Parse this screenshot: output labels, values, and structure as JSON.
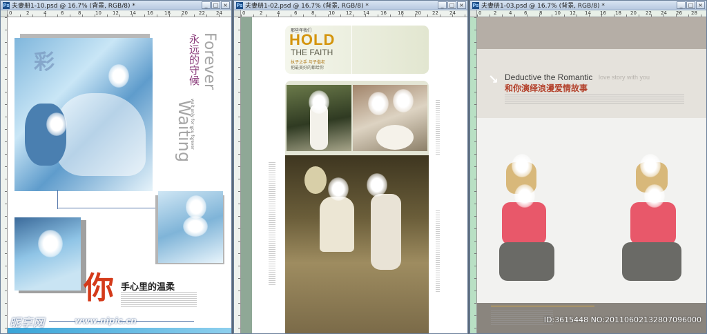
{
  "windows": [
    {
      "title": "夫妻册1-10.psd @ 16.7% (背景, RGB/8) *",
      "ruler_numbers": [
        "0",
        "2",
        "4",
        "6",
        "8",
        "10",
        "12",
        "14",
        "16",
        "18",
        "20",
        "22",
        "24"
      ],
      "ruler_left": [
        "1",
        "2",
        "3",
        "4",
        "5",
        "6",
        "7",
        "8",
        "9",
        "1",
        "1",
        "2"
      ]
    },
    {
      "title": "夫妻册1-02.psd @ 16.7% (背景, RGB/8) *",
      "ruler_numbers": [
        "0",
        "2",
        "4",
        "6",
        "8",
        "10",
        "12",
        "14",
        "16",
        "18",
        "20",
        "22",
        "24"
      ],
      "ruler_left": [
        "1",
        "2",
        "3",
        "4",
        "5",
        "6",
        "7",
        "8",
        "9",
        "1",
        "1",
        "2"
      ]
    },
    {
      "title": "夫妻册1-03.psd @ 16.7% (背景, RGB/8) *",
      "ruler_numbers": [
        "0",
        "2",
        "4",
        "6",
        "8",
        "10",
        "12",
        "14",
        "16",
        "18",
        "20",
        "22",
        "24",
        "26",
        "28"
      ],
      "ruler_left": [
        "1",
        "2",
        "3",
        "4",
        "5",
        "6",
        "7",
        "8",
        "9",
        "1",
        "1",
        "2",
        "3"
      ]
    }
  ],
  "page1": {
    "heading_cn": "永远的守候",
    "forever": "Forever",
    "waiting": "Waiting",
    "small_vertical": "wait only for you forever",
    "big_char": "你",
    "caption_cn": "手心里的温柔"
  },
  "page2": {
    "hold": "HOLD",
    "the_faith": "THE FAITH",
    "small_tag": "那些年我们",
    "tagline_1": "执子之手 与子偕老",
    "tagline_2": "把最美好的都给你"
  },
  "page3": {
    "deductive": "Deductive the Romantic",
    "love_sub": "love story with you",
    "cn_title": "和你演绎浪漫爱情故事"
  },
  "watermark": {
    "site": "昵享网",
    "url": "www.nipic.cn",
    "id_text": "ID:3615448 NO:20110602132807096000"
  },
  "icons": {
    "minimize": "_",
    "maximize": "□",
    "close": "×",
    "ps": "Ps"
  }
}
